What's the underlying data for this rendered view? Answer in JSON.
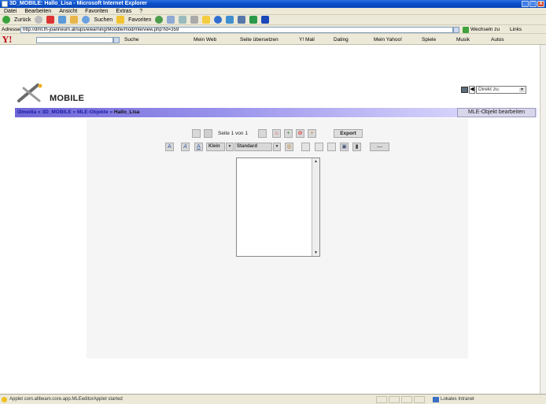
{
  "window": {
    "title": "3D_MOBILE: Hallo_Lisa - Microsoft Internet Explorer",
    "buttons": {
      "minimize": "_",
      "maximize": "□",
      "close": "X"
    }
  },
  "menu": [
    "Datei",
    "Bearbeiten",
    "Ansicht",
    "Favoriten",
    "Extras",
    "?"
  ],
  "toolbar": {
    "back_label": "Zurück",
    "search_label": "Suchen",
    "favorites_label": "Favoriten"
  },
  "address": {
    "label": "Adresse",
    "url": "http://dmt.fh-joanneum.at/lups/elearning/Moodle/mod/mle/view.php?id=359",
    "go_label": "Wechseln zu",
    "links_label": "Links"
  },
  "yahoo": {
    "logo": "Y!",
    "search_label": "Suche",
    "items": [
      "Mein Web",
      "Seite übersetzen",
      "Y! Mail",
      "Dating",
      "Mein Yahoo!",
      "Spiele",
      "Musik",
      "Autos"
    ]
  },
  "site": {
    "logo_text": "MOBILE",
    "jump_label": "Direkt zu:",
    "jump_back": "◀",
    "breadcrumb": {
      "items": [
        "i3media",
        "3D_MOBILE",
        "MLE-Objekte"
      ],
      "separator": "»",
      "current": "Hallo_Lisa"
    },
    "edit_button": "MLE-Objekt bearbeiten"
  },
  "editor": {
    "page_info": "Seite 1 von 1",
    "export_label": "Export",
    "size_value": "Klein",
    "style_value": "Standard"
  },
  "status": {
    "text": "Applet com.allbeam.core.app.MLEeditorApplet started",
    "zone": "Lokales Intranet"
  }
}
